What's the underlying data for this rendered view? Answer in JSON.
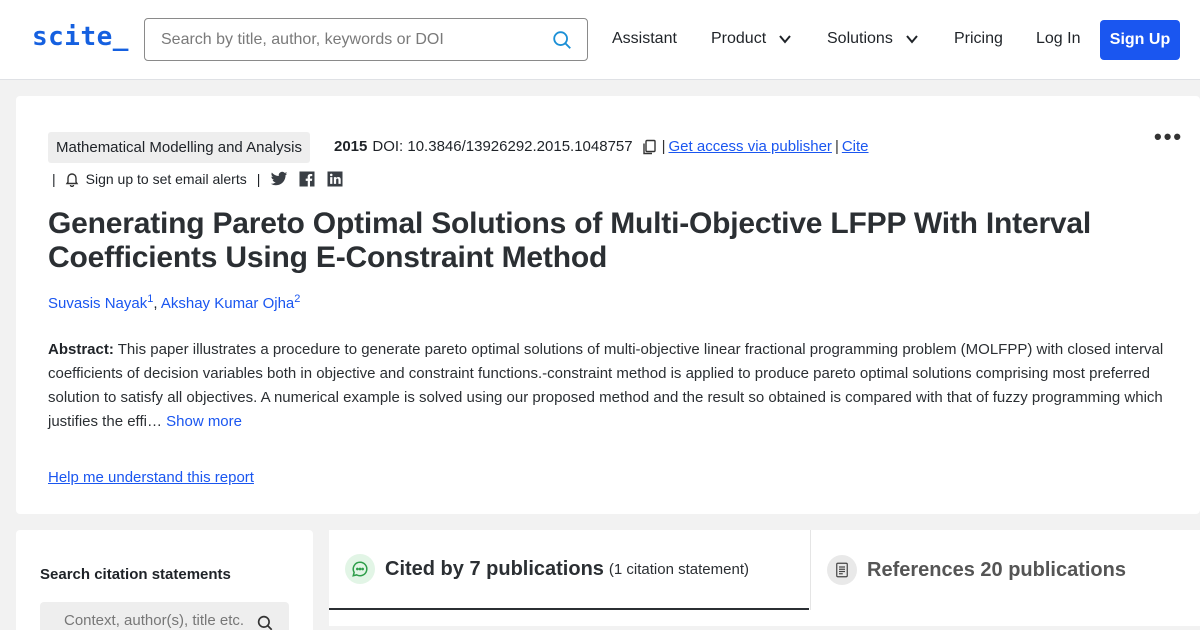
{
  "header": {
    "logo": "scite_",
    "search_placeholder": "Search by title, author, keywords or DOI",
    "nav": {
      "assistant": "Assistant",
      "product": "Product",
      "solutions": "Solutions",
      "pricing": "Pricing",
      "login": "Log In",
      "signup": "Sign Up"
    }
  },
  "paper": {
    "journal": "Mathematical Modelling and Analysis",
    "year": "2015",
    "doi": "DOI: 10.3846/13926292.2015.1048757",
    "access_link": "Get access via publisher",
    "cite_link": "Cite",
    "separator": "|",
    "email_alerts": "Sign up to set email alerts",
    "title": "Generating Pareto Optimal Solutions of Multi-Objective LFPP With Interval Coefficients Using E-Constraint Method",
    "authors": [
      {
        "name": "Suvasis Nayak",
        "sup": "1"
      },
      {
        "name": "Akshay Kumar Ojha",
        "sup": "2"
      }
    ],
    "abstract_label": "Abstract:",
    "abstract_text": " This paper illustrates a procedure to generate pareto optimal solutions of multi-objective linear fractional programming problem (MOLFPP) with closed interval coefficients of decision variables both in objective and constraint functions.-constraint method is applied to produce pareto optimal solutions comprising most preferred solution to satisfy all objectives. A numerical example is solved using our proposed method and the result so obtained is compared with that of fuzzy programming which justifies the effi… ",
    "show_more": "Show more",
    "help_link": "Help me understand this report"
  },
  "sidebar": {
    "heading": "Search citation statements",
    "placeholder": "Context, author(s), title etc."
  },
  "tabs": {
    "cited_label": "Cited by 7 publications",
    "cited_sub": "(1 citation statement)",
    "refs_label": "References 20 publications"
  },
  "colors": {
    "accent": "#1a56f0",
    "cited_icon": "#2e9e4a"
  }
}
